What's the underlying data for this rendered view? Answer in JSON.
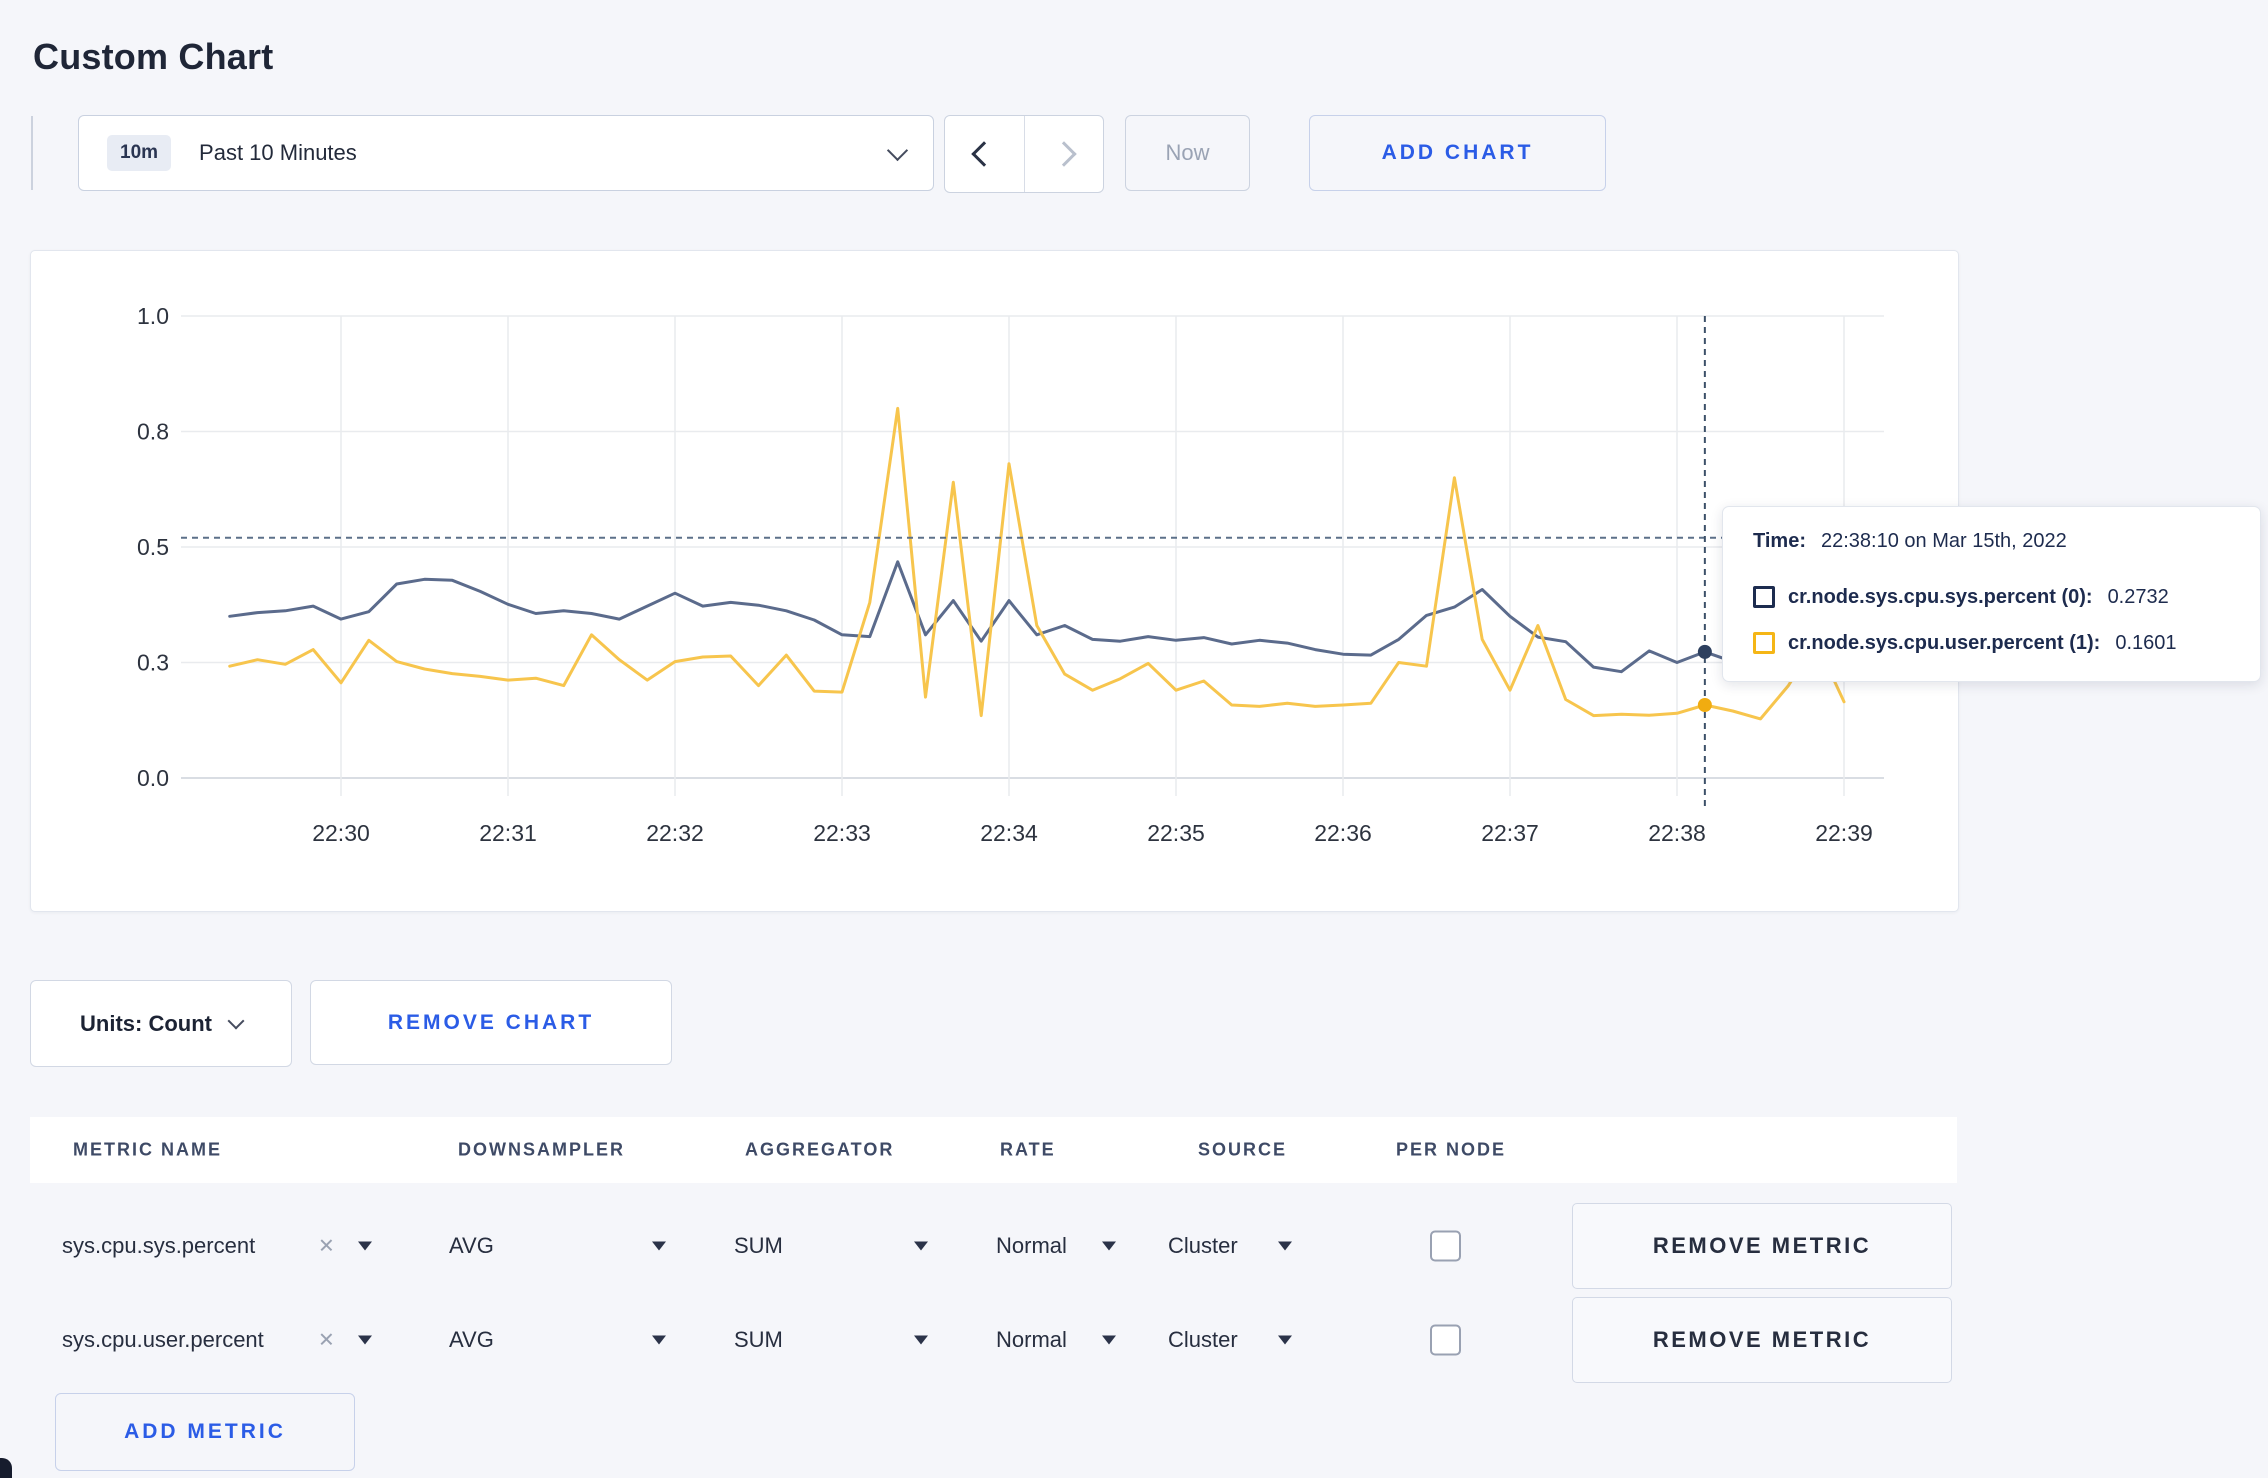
{
  "page": {
    "title": "Custom Chart",
    "background": "#f5f6fa",
    "accent_blue": "#2b5ce6"
  },
  "icons": {
    "close": "✕"
  },
  "toolbar": {
    "time_range": {
      "badge": "10m",
      "label": "Past 10 Minutes"
    },
    "now_label": "Now",
    "add_chart_label": "ADD CHART"
  },
  "chart_footer": {
    "units_label": "Units: Count",
    "remove_chart_label": "REMOVE CHART"
  },
  "tooltip": {
    "time_label": "Time:",
    "time_value": "22:38:10 on Mar 15th, 2022",
    "rows": [
      {
        "label": "cr.node.sys.cpu.sys.percent (0):",
        "value": "0.2732",
        "swatch": "#1d2c4f"
      },
      {
        "label": "cr.node.sys.cpu.user.percent (1):",
        "value": "0.1601",
        "swatch": "#f5b616"
      }
    ]
  },
  "chart_data": {
    "type": "line",
    "title": "",
    "xlabel": "",
    "ylabel": "",
    "grid": true,
    "legend_position": "tooltip",
    "x_axis": {
      "tick_labels": [
        "22:30",
        "22:31",
        "22:32",
        "22:33",
        "22:34",
        "22:35",
        "22:36",
        "22:37",
        "22:38",
        "22:39"
      ],
      "minutes_start": -0.6667,
      "step_minutes": 0.16667
    },
    "y_axis": {
      "ticks": [
        0,
        0.25,
        0.5,
        0.75,
        1.0
      ],
      "tick_labels": [
        "0.0",
        "0.3",
        "0.5",
        "0.8",
        "1.0"
      ],
      "range": [
        0,
        1
      ]
    },
    "series": [
      {
        "name": "cr.node.sys.cpu.sys.percent (0)",
        "color": "#5b6b8c",
        "dot_color": "#2e405f",
        "values": [
          0.35,
          0.358,
          0.362,
          0.372,
          0.344,
          0.36,
          0.42,
          0.43,
          0.428,
          0.404,
          0.376,
          0.356,
          0.362,
          0.356,
          0.344,
          0.372,
          0.4,
          0.372,
          0.38,
          0.374,
          0.362,
          0.342,
          0.31,
          0.306,
          0.468,
          0.31,
          0.384,
          0.296,
          0.384,
          0.31,
          0.33,
          0.3,
          0.296,
          0.306,
          0.298,
          0.304,
          0.29,
          0.298,
          0.292,
          0.278,
          0.268,
          0.266,
          0.3,
          0.352,
          0.37,
          0.408,
          0.35,
          0.305,
          0.295,
          0.24,
          0.23,
          0.275,
          0.25,
          0.273,
          0.252,
          0.272,
          0.288,
          0.265,
          0.28
        ]
      },
      {
        "name": "cr.node.sys.cpu.user.percent (1)",
        "color": "#f7c54d",
        "dot_color": "#f1ac10",
        "values": [
          0.242,
          0.256,
          0.246,
          0.278,
          0.206,
          0.298,
          0.252,
          0.236,
          0.226,
          0.22,
          0.212,
          0.216,
          0.2,
          0.31,
          0.256,
          0.212,
          0.252,
          0.262,
          0.264,
          0.2,
          0.266,
          0.188,
          0.186,
          0.38,
          0.8,
          0.175,
          0.64,
          0.135,
          0.68,
          0.33,
          0.225,
          0.19,
          0.215,
          0.248,
          0.19,
          0.21,
          0.158,
          0.155,
          0.162,
          0.155,
          0.158,
          0.162,
          0.25,
          0.242,
          0.65,
          0.3,
          0.19,
          0.33,
          0.17,
          0.135,
          0.138,
          0.136,
          0.14,
          0.158,
          0.145,
          0.128,
          0.2,
          0.295,
          0.165
        ]
      }
    ],
    "crosshair": {
      "index": 53,
      "hline_value": 0.52,
      "time": "22:38:10"
    }
  },
  "metrics_table": {
    "headers": [
      "METRIC NAME",
      "DOWNSAMPLER",
      "AGGREGATOR",
      "RATE",
      "SOURCE",
      "PER NODE"
    ],
    "rows": [
      {
        "metric": "sys.cpu.sys.percent",
        "downsampler": "AVG",
        "aggregator": "SUM",
        "rate": "Normal",
        "source": "Cluster",
        "per_node": false
      },
      {
        "metric": "sys.cpu.user.percent",
        "downsampler": "AVG",
        "aggregator": "SUM",
        "rate": "Normal",
        "source": "Cluster",
        "per_node": false
      }
    ],
    "remove_metric_label": "REMOVE METRIC",
    "add_metric_label": "ADD METRIC"
  }
}
